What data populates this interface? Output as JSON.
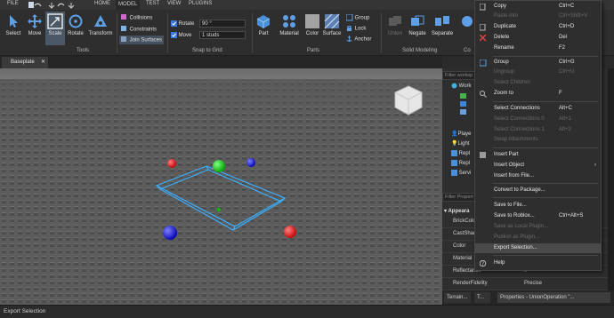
{
  "menubar": {
    "file": "FILE",
    "tabs": [
      "HOME",
      "MODEL",
      "TEST",
      "VIEW",
      "PLUGINS"
    ]
  },
  "ribbon": {
    "tools": {
      "select": "Select",
      "move": "Move",
      "scale": "Scale",
      "rotate": "Rotate",
      "transform": "Transform"
    },
    "tools_group": "Tools",
    "collisions": "Collisions",
    "constraints": "Constraints",
    "join_surfaces": "Join Surfaces",
    "rotate_label": "Rotate",
    "rotate_value": "90 °",
    "move_label": "Move",
    "move_value": "1 studs",
    "snap_group": "Snap to Grid",
    "part": "Part",
    "material": "Material",
    "color": "Color",
    "surface": "Surface",
    "group": "Group",
    "lock": "Lock",
    "anchor": "Anchor",
    "parts_group": "Parts",
    "union": "Union",
    "negate": "Negate",
    "separate": "Separate",
    "solid_group": "Solid Modeling",
    "cut_label": "Co"
  },
  "doc_tab": "Baseplate",
  "panel": {
    "explorer_filter": "Filter worksp",
    "tree": [
      "Work",
      "Playe",
      "Light",
      "Repl",
      "Repl",
      "Servi"
    ],
    "properties_filter": "Filter Propert",
    "appearance": "Appeara",
    "props": [
      {
        "k": "BrickColo",
        "v": ""
      },
      {
        "k": "CastShad",
        "v": ""
      },
      {
        "k": "Color",
        "v": ""
      },
      {
        "k": "Material",
        "v": ""
      },
      {
        "k": "Reflectance",
        "v": "0"
      },
      {
        "k": "RenderFidelity",
        "v": "Precise"
      }
    ],
    "bottom_tabs": [
      "Terrain...",
      "T...",
      "Properties - UnionOperation \"..."
    ]
  },
  "context_menu": {
    "items": [
      {
        "label": "Copy",
        "shortcut": "Ctrl+C",
        "enabled": true
      },
      {
        "label": "Paste Into",
        "shortcut": "Ctrl+Shift+V",
        "enabled": false
      },
      {
        "label": "Duplicate",
        "shortcut": "Ctrl+D",
        "enabled": true
      },
      {
        "label": "Delete",
        "shortcut": "Del",
        "enabled": true
      },
      {
        "label": "Rename",
        "shortcut": "F2",
        "enabled": true
      },
      {
        "label": "Group",
        "shortcut": "Ctrl+G",
        "enabled": true
      },
      {
        "label": "Ungroup",
        "shortcut": "Ctrl+U",
        "enabled": false
      },
      {
        "label": "Select Children",
        "shortcut": "",
        "enabled": false
      },
      {
        "label": "Zoom to",
        "shortcut": "F",
        "enabled": true
      },
      {
        "label": "Select Connections",
        "shortcut": "Alt+C",
        "enabled": true
      },
      {
        "label": "Select Connections 0",
        "shortcut": "Alt+1",
        "enabled": false
      },
      {
        "label": "Select Connections 1",
        "shortcut": "Alt+2",
        "enabled": false
      },
      {
        "label": "Swap Attachments",
        "shortcut": "",
        "enabled": false
      },
      {
        "label": "Insert Part",
        "shortcut": "",
        "enabled": true
      },
      {
        "label": "Insert Object",
        "shortcut": "",
        "enabled": true
      },
      {
        "label": "Insert from File...",
        "shortcut": "",
        "enabled": true
      },
      {
        "label": "Convert to Package...",
        "shortcut": "",
        "enabled": true
      },
      {
        "label": "Save to File...",
        "shortcut": "",
        "enabled": true
      },
      {
        "label": "Save to Roblox...",
        "shortcut": "Ctrl+Alt+S",
        "enabled": true
      },
      {
        "label": "Save as Local Plugin...",
        "shortcut": "",
        "enabled": false
      },
      {
        "label": "Publish as Plugin...",
        "shortcut": "",
        "enabled": false
      },
      {
        "label": "Export Selection...",
        "shortcut": "",
        "enabled": true
      },
      {
        "label": "Help",
        "shortcut": "",
        "enabled": true
      }
    ]
  },
  "status": "Export Selection"
}
